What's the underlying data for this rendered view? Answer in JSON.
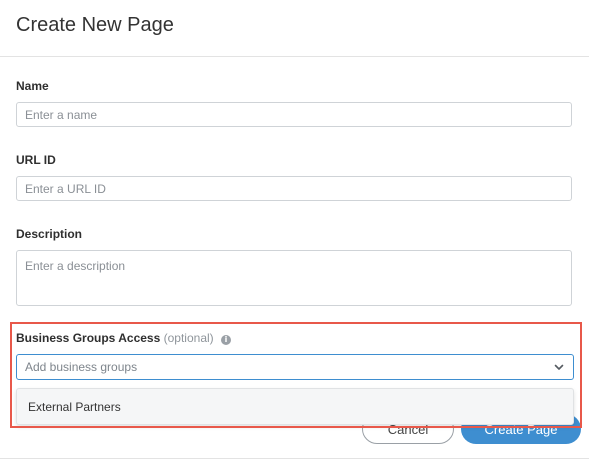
{
  "dialog": {
    "title": "Create New Page"
  },
  "form": {
    "name": {
      "label": "Name",
      "placeholder": "Enter a name",
      "value": ""
    },
    "url_id": {
      "label": "URL ID",
      "placeholder": "Enter a URL ID",
      "value": ""
    },
    "description": {
      "label": "Description",
      "placeholder": "Enter a description",
      "value": ""
    },
    "business_groups": {
      "label": "Business Groups Access",
      "optional": "(optional)",
      "info_icon": "info-icon",
      "placeholder": "Add business groups",
      "value": "",
      "chevron_icon": "chevron-down-icon",
      "options": [
        "External Partners"
      ]
    }
  },
  "footer": {
    "cancel_label": "Cancel",
    "create_label": "Create Page"
  },
  "colors": {
    "accent": "#3e8ed0",
    "highlight": "#e8584a"
  }
}
